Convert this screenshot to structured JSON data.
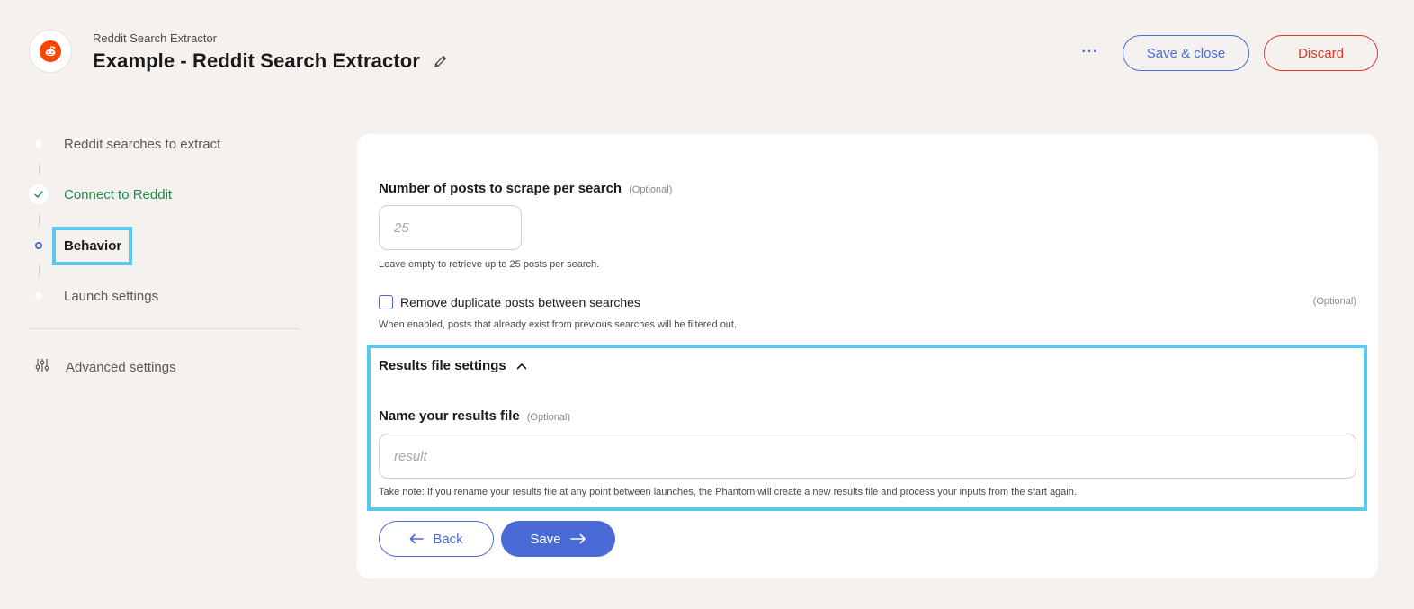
{
  "header": {
    "app_name": "Reddit Search Extractor",
    "title": "Example - Reddit Search Extractor",
    "more_label": "···",
    "save_close_label": "Save & close",
    "discard_label": "Discard",
    "logo_icon": "reddit-logo",
    "edit_icon": "pencil-icon"
  },
  "sidebar": {
    "steps": [
      {
        "label": "Reddit searches to extract",
        "state": "pending"
      },
      {
        "label": "Connect to Reddit",
        "state": "done"
      },
      {
        "label": "Behavior",
        "state": "active"
      },
      {
        "label": "Launch settings",
        "state": "pending"
      }
    ],
    "advanced_label": "Advanced settings",
    "advanced_icon": "sliders-icon"
  },
  "form": {
    "posts_label": "Number of posts to scrape per search",
    "posts_optional": "(Optional)",
    "posts_placeholder": "25",
    "posts_help": "Leave empty to retrieve up to 25 posts per search.",
    "dedupe_label": "Remove duplicate posts between searches",
    "dedupe_optional": "(Optional)",
    "dedupe_help": "When enabled, posts that already exist from previous searches will be filtered out.",
    "results_section_label": "Results file settings",
    "results_name_label": "Name your results file",
    "results_name_optional": "(Optional)",
    "results_name_placeholder": "result",
    "results_help": "Take note: If you rename your results file at any point between launches, the Phantom will create a new results file and process your inputs from the start again.",
    "back_label": "Back",
    "save_label": "Save"
  },
  "colors": {
    "accent": "#4a6ad8",
    "danger": "#d83a2e",
    "success": "#1f8a4c",
    "highlight": "#5ac8ea",
    "background": "#f5f1ee"
  }
}
